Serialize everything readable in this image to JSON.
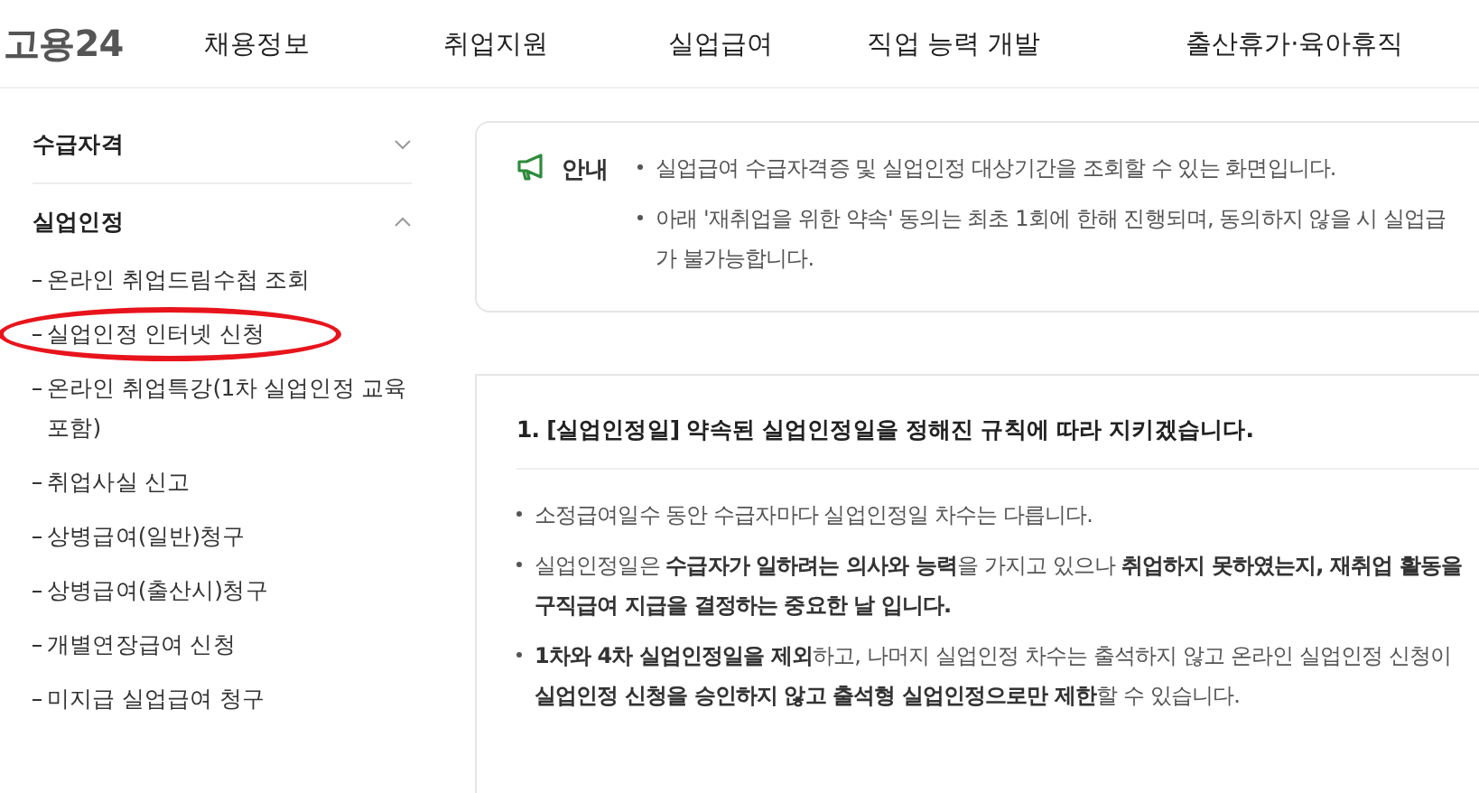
{
  "header": {
    "logo": "고용24",
    "nav": [
      "채용정보",
      "취업지원",
      "실업급여",
      "직업 능력 개발",
      "출산휴가·육아휴직"
    ]
  },
  "sidebar": {
    "sections": [
      {
        "title": "수급자격",
        "expanded": false
      },
      {
        "title": "실업인정",
        "expanded": true,
        "items": [
          {
            "label": "온라인 취업드림수첩 조회",
            "circled": false
          },
          {
            "label": "실업인정 인터넷 신청",
            "circled": true
          },
          {
            "label": "온라인 취업특강(1차 실업인정 교육 포함)",
            "circled": false
          },
          {
            "label": "취업사실 신고",
            "circled": false
          },
          {
            "label": "상병급여(일반)청구",
            "circled": false
          },
          {
            "label": "상병급여(출산시)청구",
            "circled": false
          },
          {
            "label": "개별연장급여 신청",
            "circled": false
          },
          {
            "label": "미지급 실업급여 청구",
            "circled": false
          }
        ]
      }
    ]
  },
  "notice": {
    "label": "안내",
    "bullets": [
      {
        "lines": [
          "실업급여 수급자격증 및 실업인정 대상기간을 조회할 수 있는 화면입니다."
        ]
      },
      {
        "lines": [
          "아래 '재취업을 위한 약속' 동의는 최초 1회에 한해 진행되며, 동의하지 않을 시 실업급",
          "가 불가능합니다."
        ]
      }
    ]
  },
  "rule": {
    "title": "1. [실업인정일] 약속된 실업인정일을 정해진 규칙에 따라 지키겠습니다.",
    "bullets": [
      {
        "lines": [
          "소정급여일수 동안 수급자마다 실업인정일 차수는 다릅니다."
        ]
      },
      {
        "lines": [
          "실업인정일은 **수급자가 일하려는 의사와 능력**을 가지고 있으나 **취업하지 못하였는지, 재취업 활동을**",
          "**구직급여 지급을 결정하는 중요한 날 입니다.**"
        ]
      },
      {
        "lines": [
          "**1차와 4차 실업인정일을 제외**하고, 나머지 실업인정 차수는 출석하지 않고 온라인 실업인정 신청이",
          "**실업인정 신청을 승인하지 않고 출석형 실업인정으로만 제한**할 수 있습니다."
        ]
      }
    ]
  }
}
